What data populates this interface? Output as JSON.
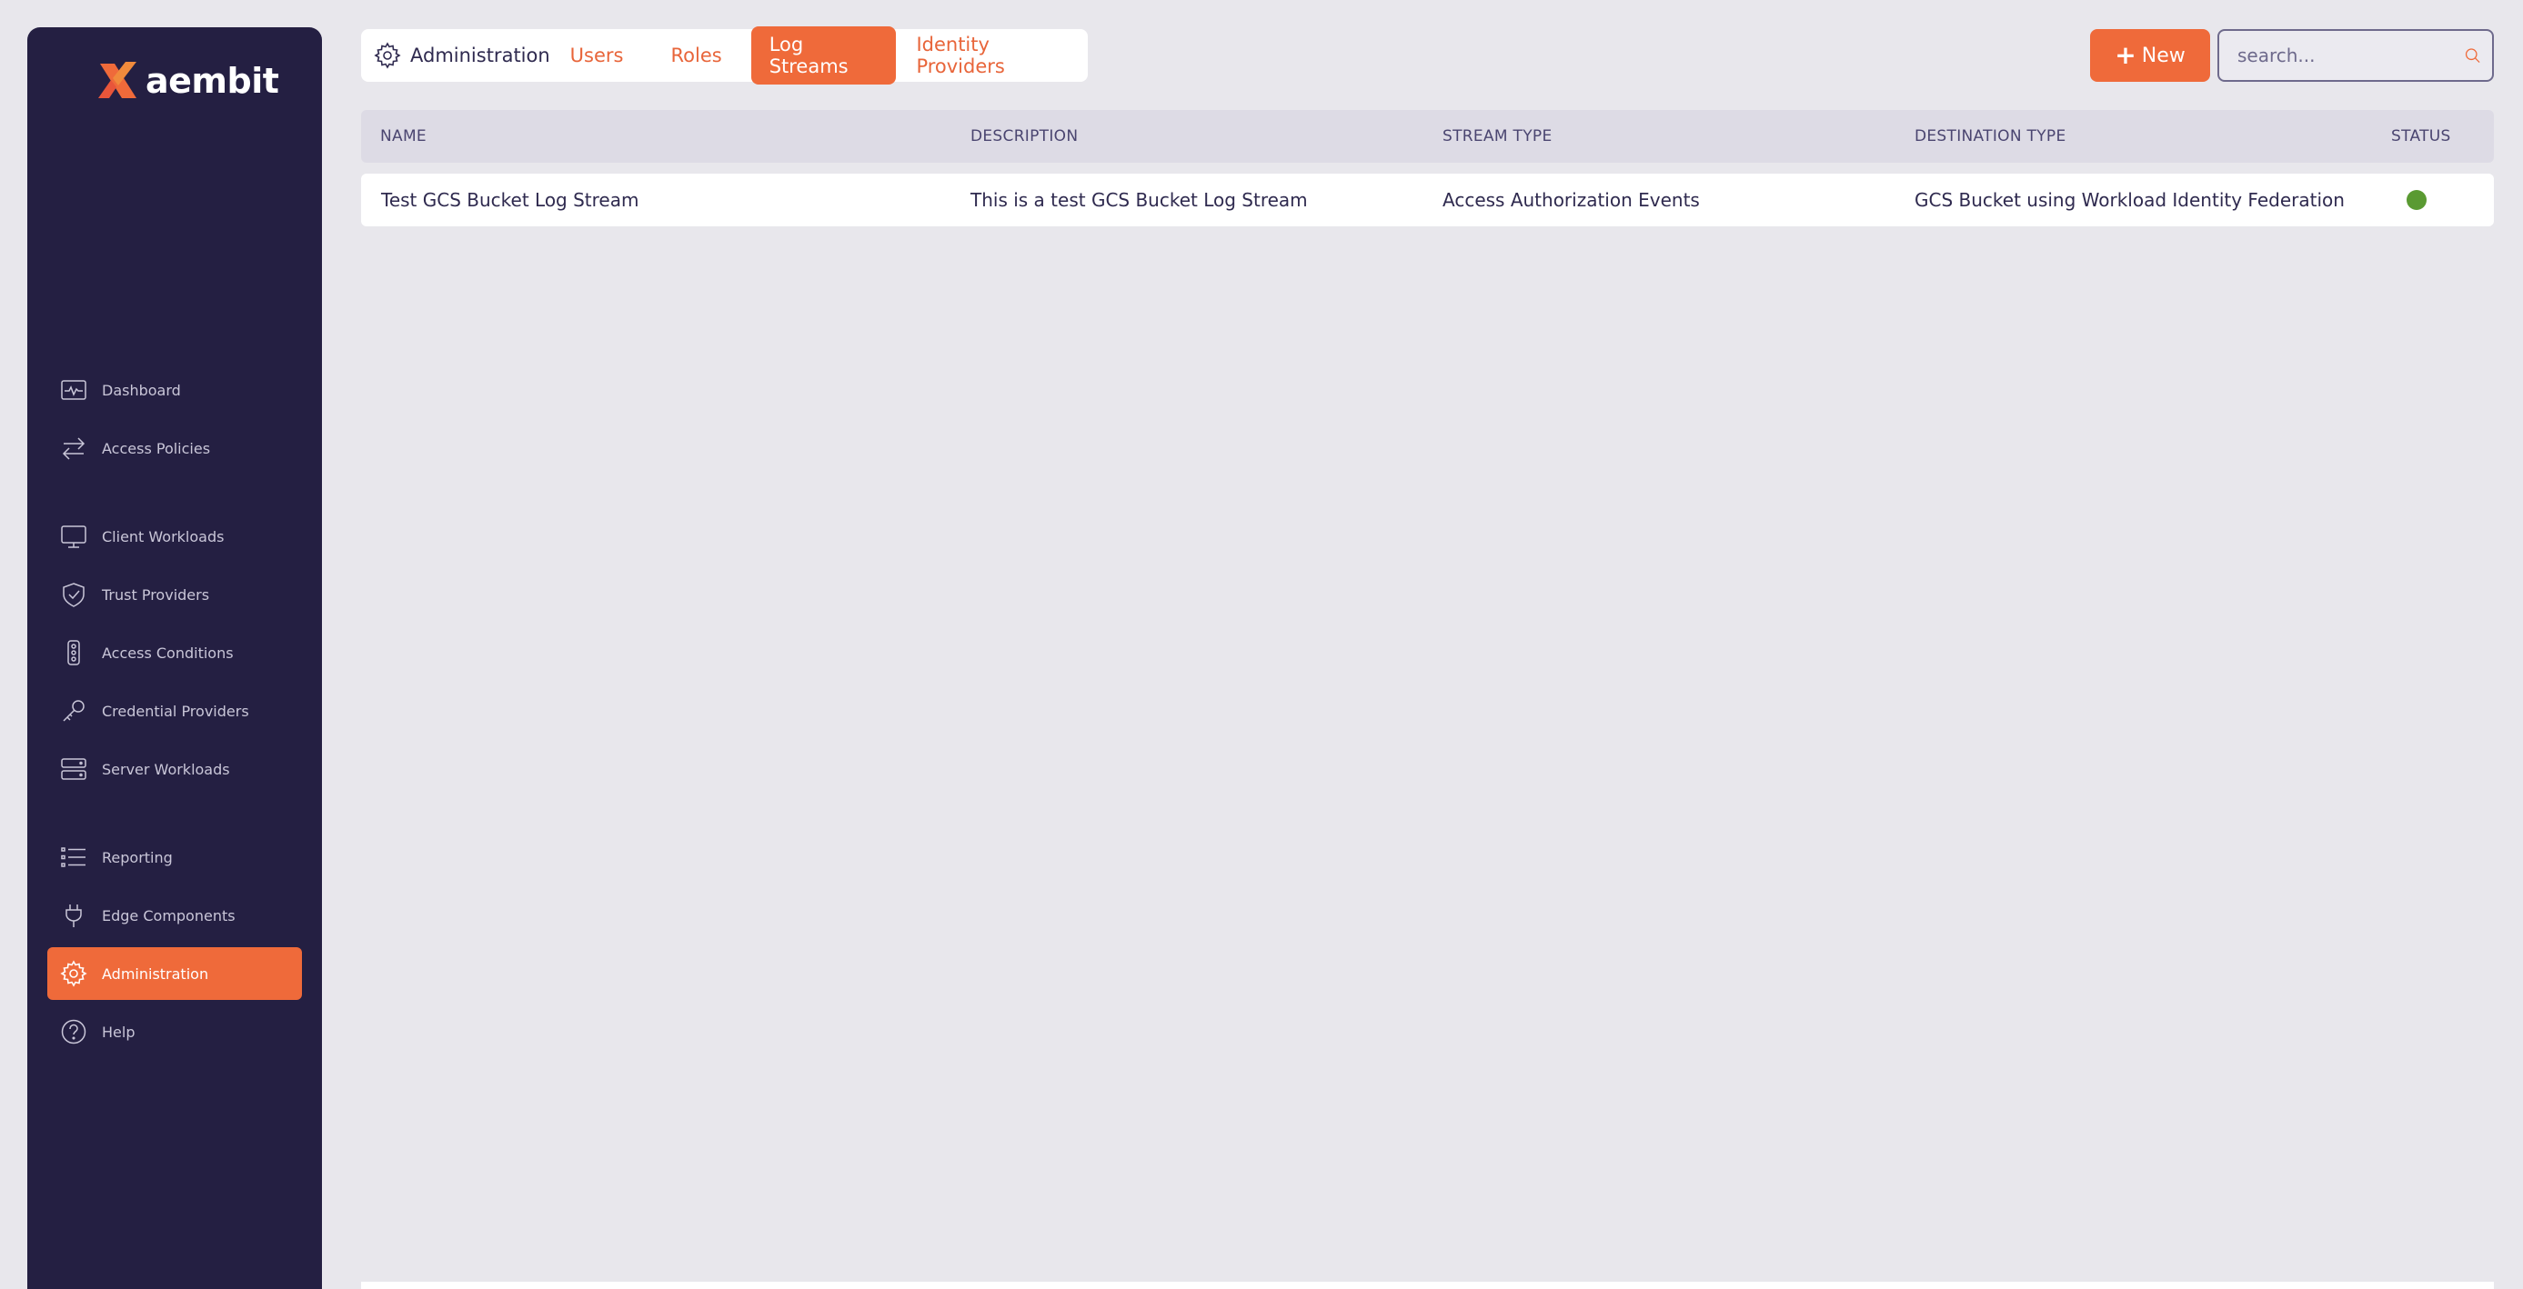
{
  "brand": {
    "name": "aembit",
    "accent": "#ef6a3a",
    "sidebar_bg": "#241f42"
  },
  "sidebar": {
    "items": [
      {
        "label": "Dashboard",
        "icon": "dashboard-icon",
        "active": false
      },
      {
        "label": "Access Policies",
        "icon": "arrows-exchange-icon",
        "active": false
      },
      {
        "label": "Client Workloads",
        "icon": "monitor-icon",
        "active": false
      },
      {
        "label": "Trust Providers",
        "icon": "shield-check-icon",
        "active": false
      },
      {
        "label": "Access Conditions",
        "icon": "traffic-light-icon",
        "active": false
      },
      {
        "label": "Credential Providers",
        "icon": "key-icon",
        "active": false
      },
      {
        "label": "Server Workloads",
        "icon": "server-icon",
        "active": false
      },
      {
        "label": "Reporting",
        "icon": "list-icon",
        "active": false
      },
      {
        "label": "Edge Components",
        "icon": "plug-icon",
        "active": false
      },
      {
        "label": "Administration",
        "icon": "gear-icon",
        "active": true
      },
      {
        "label": "Help",
        "icon": "help-circle-icon",
        "active": false
      }
    ]
  },
  "header": {
    "section_title": "Administration",
    "tabs": [
      {
        "label": "Users",
        "active": false
      },
      {
        "label": "Roles",
        "active": false
      },
      {
        "label": "Log Streams",
        "active": true
      },
      {
        "label": "Identity Providers",
        "active": false
      }
    ],
    "new_button_label": "New",
    "search_placeholder": "search..."
  },
  "table": {
    "columns": [
      "NAME",
      "DESCRIPTION",
      "STREAM TYPE",
      "DESTINATION TYPE",
      "STATUS"
    ],
    "rows": [
      {
        "name": "Test GCS Bucket Log Stream",
        "description": "This is a test GCS Bucket Log Stream",
        "stream_type": "Access Authorization Events",
        "destination_type": "GCS Bucket using Workload Identity Federation",
        "status": "active",
        "status_color": "#5a9a32"
      }
    ]
  }
}
